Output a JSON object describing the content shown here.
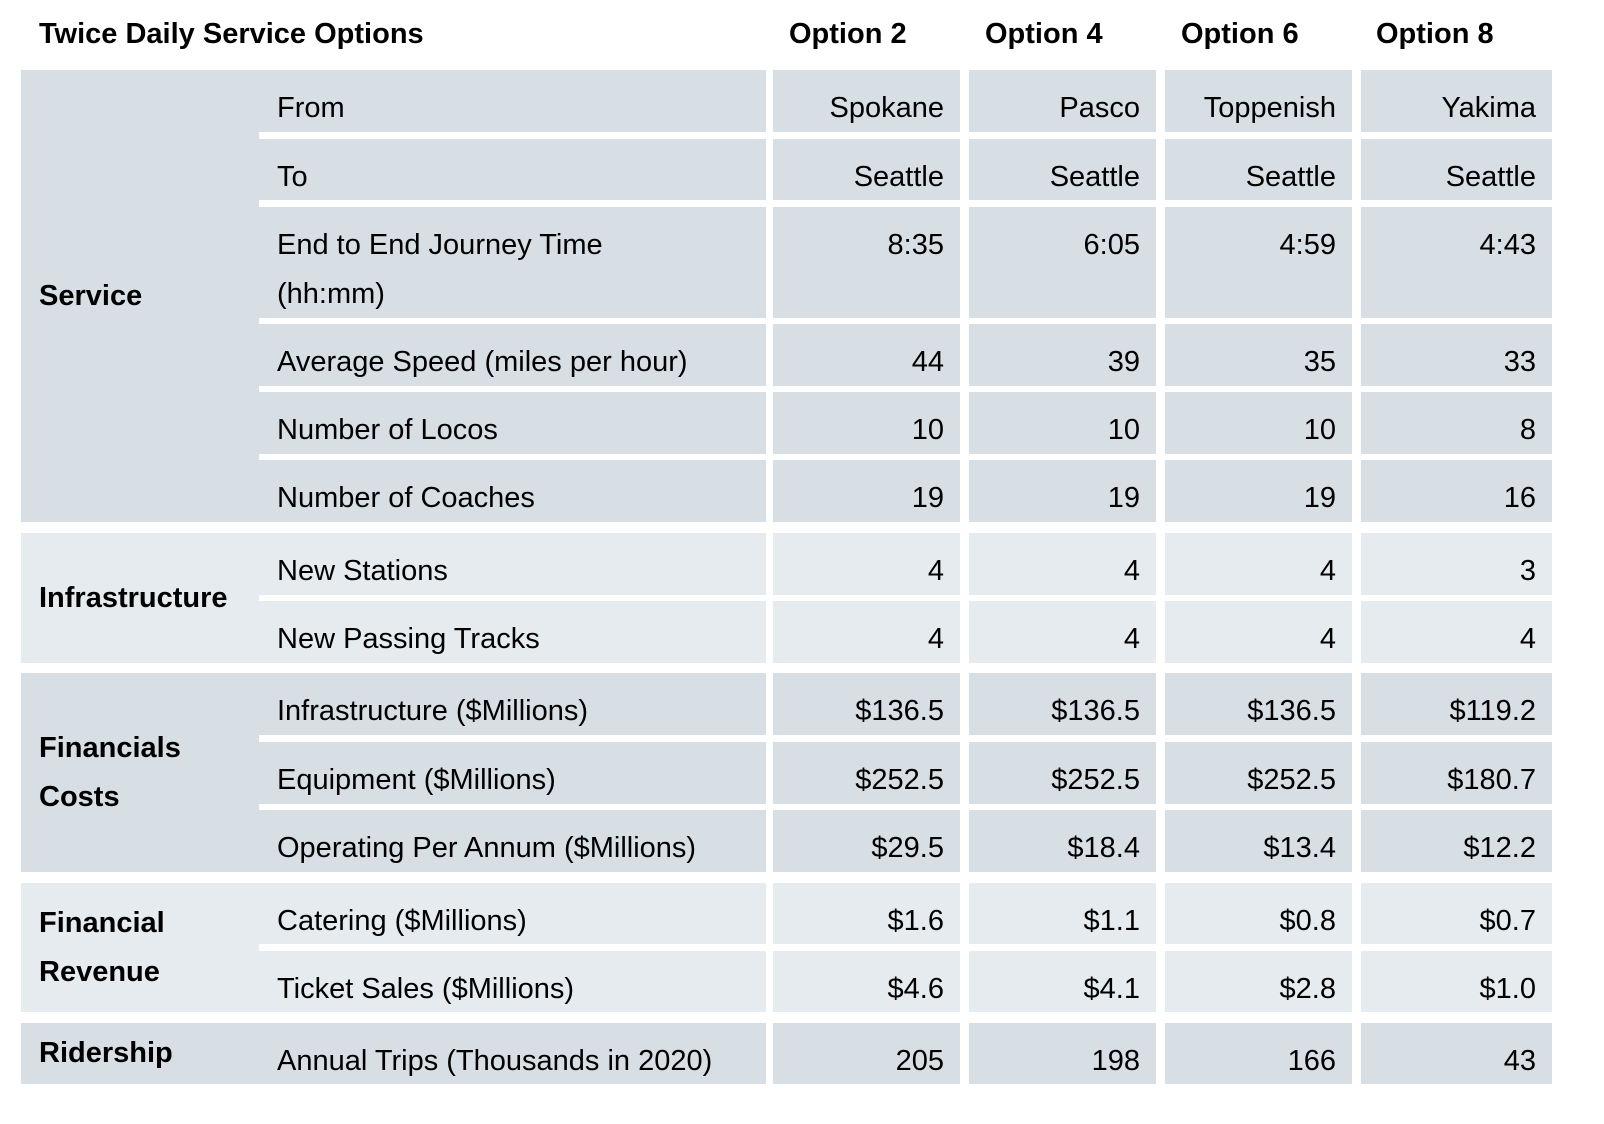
{
  "title": "Twice Daily Service Options",
  "options": [
    "Option 2",
    "Option 4",
    "Option 6",
    "Option 8"
  ],
  "groups": [
    {
      "label": "Service"
    },
    {
      "label": "Infrastructure"
    },
    {
      "label": "Financials Costs"
    },
    {
      "label": "Financial Revenue"
    },
    {
      "label": "Ridership"
    }
  ],
  "rows": [
    {
      "label": "From",
      "values": [
        "Spokane",
        "Pasco",
        "Toppenish",
        "Yakima"
      ]
    },
    {
      "label": "To",
      "values": [
        "Seattle",
        "Seattle",
        "Seattle",
        "Seattle"
      ]
    },
    {
      "label": "End to End Journey Time (hh:mm)",
      "values": [
        "8:35",
        "6:05",
        "4:59",
        "4:43"
      ]
    },
    {
      "label": "Average Speed (miles per hour)",
      "values": [
        "44",
        "39",
        "35",
        "33"
      ]
    },
    {
      "label": "Number of Locos",
      "values": [
        "10",
        "10",
        "10",
        "8"
      ]
    },
    {
      "label": "Number of Coaches",
      "values": [
        "19",
        "19",
        "19",
        "16"
      ]
    },
    {
      "label": "New Stations",
      "values": [
        "4",
        "4",
        "4",
        "3"
      ]
    },
    {
      "label": "New Passing Tracks",
      "values": [
        "4",
        "4",
        "4",
        "4"
      ]
    },
    {
      "label": "Infrastructure ($Millions)",
      "values": [
        "$136.5",
        "$136.5",
        "$136.5",
        "$119.2"
      ]
    },
    {
      "label": "Equipment ($Millions)",
      "values": [
        "$252.5",
        "$252.5",
        "$252.5",
        "$180.7"
      ]
    },
    {
      "label": "Operating Per Annum ($Millions)",
      "values": [
        "$29.5",
        "$18.4",
        "$13.4",
        "$12.2"
      ]
    },
    {
      "label": "Catering ($Millions)",
      "values": [
        "$1.6",
        "$1.1",
        "$0.8",
        "$0.7"
      ]
    },
    {
      "label": "Ticket Sales ($Millions)",
      "values": [
        "$4.6",
        "$4.1",
        "$2.8",
        "$1.0"
      ]
    },
    {
      "label": "Annual Trips (Thousands in 2020)",
      "values": [
        "205",
        "198",
        "166",
        "43"
      ]
    }
  ],
  "colors": {
    "dark_band": "#D7DEE4",
    "light_band": "#E6EBEF"
  }
}
